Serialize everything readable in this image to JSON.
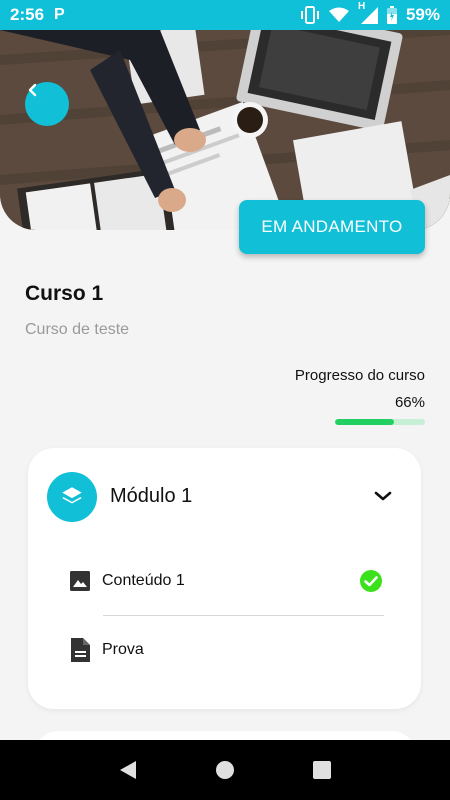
{
  "status_bar": {
    "time": "2:56",
    "carrier_badge": "P",
    "network_badge": "H",
    "battery": "59%"
  },
  "hero": {
    "back_icon": "chevron-left-icon"
  },
  "course": {
    "status_label": "EM ANDAMENTO",
    "title": "Curso 1",
    "subtitle": "Curso de teste",
    "progress_label": "Progresso do curso",
    "progress_text": "66%",
    "progress_fraction": 0.66
  },
  "module": {
    "title": "Módulo 1",
    "icon": "layers-icon",
    "expanded": true,
    "lessons": [
      {
        "label": "Conteúdo 1",
        "icon": "image-icon",
        "completed": true
      },
      {
        "label": "Prova",
        "icon": "document-icon",
        "completed": false
      }
    ]
  },
  "colors": {
    "accent": "#11bfd7",
    "progress": "#22d062",
    "check": "#3be11b"
  }
}
